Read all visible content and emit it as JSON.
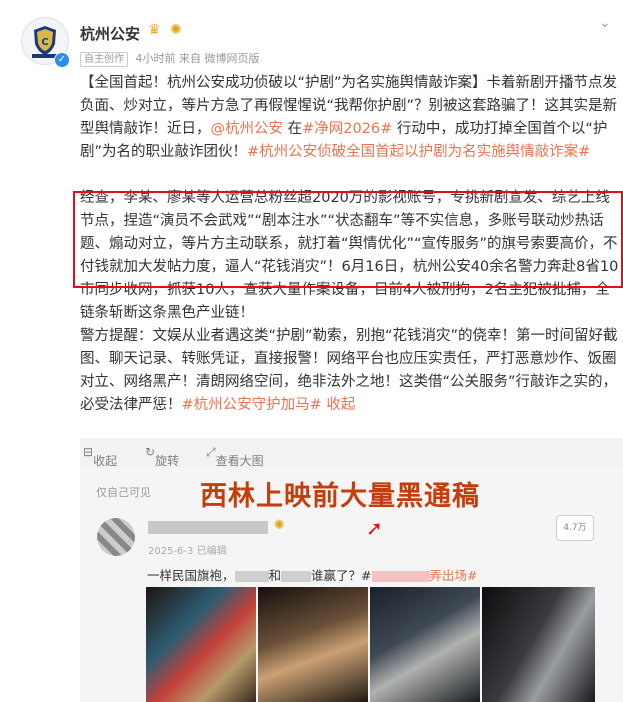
{
  "post": {
    "author": "杭州公安",
    "verified": true,
    "tag": "自主创作",
    "time": "4小时前",
    "source": "来自 微博网页版",
    "p1_a": "【全国首起！杭州公安成功侦破以“护剧”为名实施舆情敲诈案】卡着新剧开播节点发负面、炒对立，等片方急了再假惺惺说“我帮你护剧”？别被这套路骗了！这其实是新型舆情敲诈！近日，",
    "p1_mention": "@杭州公安",
    "p1_b": " 在",
    "p1_topic1": "#净网2026#",
    "p1_c": " 行动中，成功打掉全国首个以“护剧”为名的职业敲诈团伙！",
    "p1_topic2": "#杭州公安侦破全国首起以护剧为名实施舆情敲诈案#",
    "p2": "经查，李某、廖某等人运营总粉丝超2020万的影视账号，专挑新剧宣发、综艺上线节点，捏造“演员不会武戏”“剧本注水”“状态翻车”等不实信息，多账号联动炒热话题、煽动对立，等片方主动联系，就打着“舆情优化”“宣传服务”的旗号索要高价，不付钱就加大发帖力度，逼人“花钱消灾”！6月16日，杭州公安40余名警力奔赴8省10市同步收网，抓获10人，查获大量作案设备，目前4人被刑拘，2名主犯被批捕，全链条斩断这条黑色产业链！",
    "p3_a": "警方提醒：文娱从业者遇这类“护剧”勒索，别抱“花钱消灾”的侥幸！第一时间留好截图、聊天记录、转账凭证，直接报警！网络平台也应压实责任，严打恶意炒作、饭圈对立、网络黑产！清朗网络空间，绝非法外之地！这类借“公关服务”行敲诈之实的，必受法律严惩！",
    "p3_topic": "#杭州公安守护加马#",
    "collapse": "收起"
  },
  "toolbar": {
    "collapse": "收起",
    "rotate": "旋转",
    "view_large": "查看大图"
  },
  "card": {
    "visibility": "仅自己可见",
    "overlay_caption": "西林上映前大量黑通稿",
    "date": "2025-6-3",
    "edited": "已编辑",
    "count": "4.7万",
    "text_a": "一样民国旗袍，",
    "text_b": "和",
    "text_c": "谁赢了？#",
    "text_d": "弄出场#"
  },
  "icons": {
    "badge1": "crown-icon",
    "badge2": "sunflower-icon",
    "chevron": "chevron-down-icon"
  },
  "colors": {
    "highlight": "#eb7350",
    "annotation_red": "#e0101b",
    "overlay_text": "#c63c0a",
    "verify_blue": "#2a8df0"
  }
}
